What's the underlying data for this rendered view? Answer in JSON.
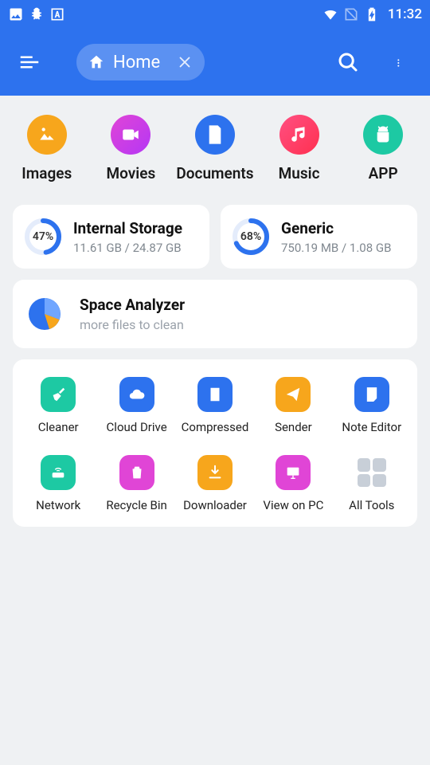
{
  "status": {
    "time": "11:32"
  },
  "appbar": {
    "home": "Home"
  },
  "categories": [
    {
      "label": "Images",
      "bg": "#F7A61C"
    },
    {
      "label": "Movies",
      "bg": "linear-gradient(135deg,#E045D6,#B537F5)"
    },
    {
      "label": "Documents",
      "bg": "#2D72EE"
    },
    {
      "label": "Music",
      "bg": "linear-gradient(135deg,#FF5082,#FF3050)"
    },
    {
      "label": "APP",
      "bg": "#1DC9A3"
    }
  ],
  "storage": [
    {
      "title": "Internal Storage",
      "sub": "11.61 GB / 24.87 GB",
      "pct": 47
    },
    {
      "title": "Generic",
      "sub": "750.19 MB / 1.08 GB",
      "pct": 68
    }
  ],
  "analyzer": {
    "title": "Space Analyzer",
    "sub": "more files to clean"
  },
  "tools": [
    {
      "label": "Cleaner",
      "bg": "#1DC9A3"
    },
    {
      "label": "Cloud Drive",
      "bg": "#2D72EE"
    },
    {
      "label": "Compressed",
      "bg": "#2D72EE"
    },
    {
      "label": "Sender",
      "bg": "#F7A61C"
    },
    {
      "label": "Note Editor",
      "bg": "#2D72EE"
    },
    {
      "label": "Network",
      "bg": "#1DC9A3"
    },
    {
      "label": "Recycle Bin",
      "bg": "#E045D6"
    },
    {
      "label": "Downloader",
      "bg": "#F7A61C"
    },
    {
      "label": "View on PC",
      "bg": "#E045D6"
    },
    {
      "label": "All Tools",
      "bg": ""
    }
  ]
}
